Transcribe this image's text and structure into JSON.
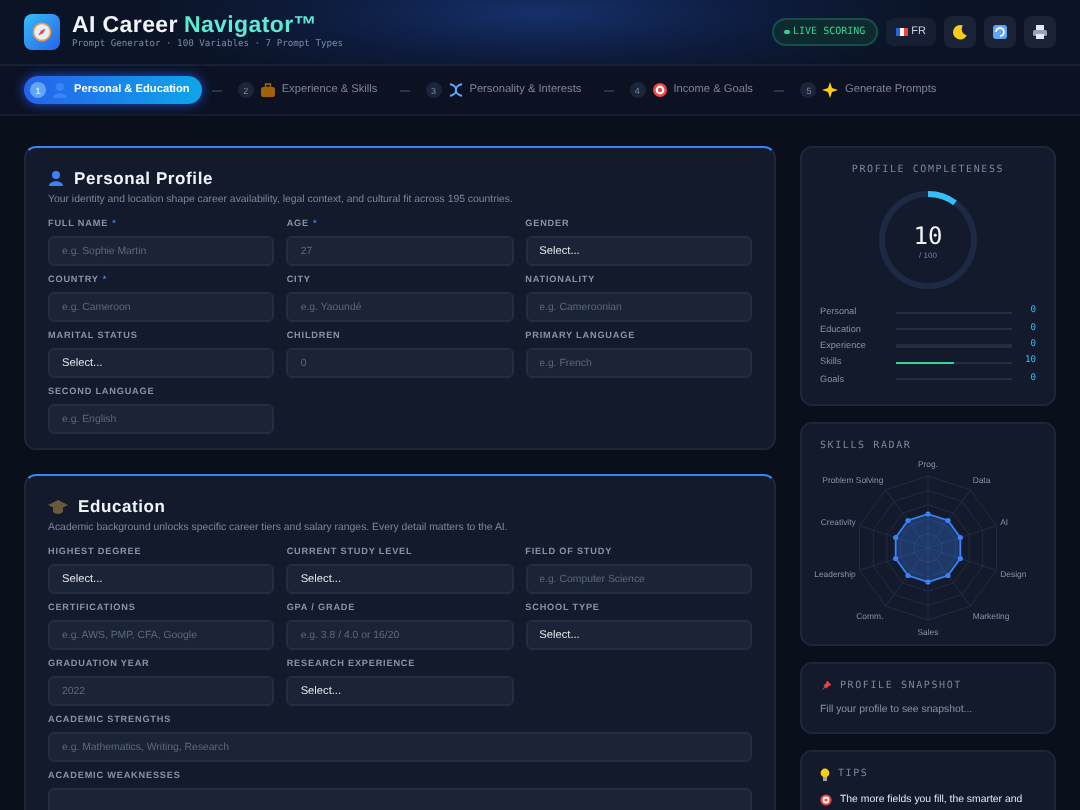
{
  "header": {
    "title": "AI Career",
    "title_accent": "Navigator™",
    "subtitle": "Prompt Generator · 100 Variables · 7 Prompt Types",
    "live_badge": "LIVE SCORING",
    "language": "FR",
    "buttons": [
      {
        "kind": "theme"
      },
      {
        "kind": "refresh"
      },
      {
        "kind": "print"
      }
    ]
  },
  "steps": [
    {
      "number": "1",
      "label": "Personal & Education",
      "selected": true
    },
    {
      "number": "2",
      "label": "Experience & Skills",
      "selected": false
    },
    {
      "number": "3",
      "label": "Personality & Interests",
      "selected": false
    },
    {
      "number": "4",
      "label": "Income & Goals",
      "selected": false
    },
    {
      "number": "5",
      "label": "Generate Prompts",
      "selected": false
    }
  ],
  "sections": [
    {
      "title": "Personal Profile",
      "description": "Your identity and location shape career availability, legal context, and cultural fit across 195 countries.",
      "fields": [
        {
          "label": "FULL NAME",
          "required_mark": "*",
          "kind": "input",
          "placeholder": "e.g. Sophie Martin"
        },
        {
          "label": "AGE",
          "required_mark": "*",
          "kind": "input",
          "placeholder": "27"
        },
        {
          "label": "GENDER",
          "kind": "select",
          "value": "Select..."
        },
        {
          "label": "COUNTRY",
          "required_mark": "*",
          "kind": "input",
          "placeholder": "e.g. Cameroon"
        },
        {
          "label": "CITY",
          "kind": "input",
          "placeholder": "e.g. Yaoundé"
        },
        {
          "label": "NATIONALITY",
          "kind": "input",
          "placeholder": "e.g. Cameroonian"
        },
        {
          "label": "MARITAL STATUS",
          "kind": "select",
          "value": "Select..."
        },
        {
          "label": "CHILDREN",
          "kind": "input",
          "placeholder": "0"
        },
        {
          "label": "PRIMARY LANGUAGE",
          "kind": "input",
          "placeholder": "e.g. French"
        },
        {
          "label": "SECOND LANGUAGE",
          "kind": "input",
          "placeholder": "e.g. English"
        }
      ]
    },
    {
      "title": "Education",
      "description": "Academic background unlocks specific career tiers and salary ranges. Every detail matters to the AI.",
      "fields": [
        {
          "label": "HIGHEST DEGREE",
          "kind": "select",
          "value": "Select..."
        },
        {
          "label": "CURRENT STUDY LEVEL",
          "kind": "select",
          "value": "Select..."
        },
        {
          "label": "FIELD OF STUDY",
          "kind": "input",
          "placeholder": "e.g. Computer Science"
        },
        {
          "label": "CERTIFICATIONS",
          "kind": "input",
          "placeholder": "e.g. AWS, PMP, CFA, Google"
        },
        {
          "label": "GPA / GRADE",
          "kind": "input",
          "placeholder": "e.g. 3.8 / 4.0 or 16/20"
        },
        {
          "label": "SCHOOL TYPE",
          "kind": "select",
          "value": "Select..."
        },
        {
          "label": "GRADUATION YEAR",
          "kind": "input",
          "placeholder": "2022"
        },
        {
          "label": "RESEARCH EXPERIENCE",
          "kind": "select",
          "value": "Select..."
        },
        {
          "label": "ACADEMIC STRENGTHS",
          "kind": "input",
          "wide": true,
          "placeholder": "e.g. Mathematics, Writing, Research"
        },
        {
          "label": "ACADEMIC WEAKNESSES",
          "kind": "input",
          "wide": true
        }
      ]
    }
  ],
  "sidebar": {
    "completeness": {
      "title": "PROFILE COMPLETENESS",
      "score": "10",
      "level": 0.1,
      "out_of": "/ 100",
      "rows": [
        {
          "label": "Personal",
          "level": 0,
          "value": "0"
        },
        {
          "label": "Education",
          "level": 0,
          "value": "0"
        },
        {
          "label": "Experience",
          "level": 0,
          "value": "0"
        },
        {
          "label": "Skills",
          "level": 0.5,
          "value": "10"
        },
        {
          "label": "Goals",
          "level": 0,
          "value": "0"
        }
      ]
    },
    "radar": {
      "title": "SKILLS RADAR",
      "axes": [
        "Prog.",
        "Problem Solving",
        "Data",
        "Creativity",
        "AI",
        "Leadership",
        "Design",
        "Comm.",
        "Marketing",
        "Sales"
      ]
    },
    "snapshot": {
      "title": "PROFILE SNAPSHOT",
      "text": "Fill your profile to see snapshot..."
    },
    "tips": {
      "title": "TIPS",
      "text": "The more fields you fill, the smarter and"
    }
  }
}
